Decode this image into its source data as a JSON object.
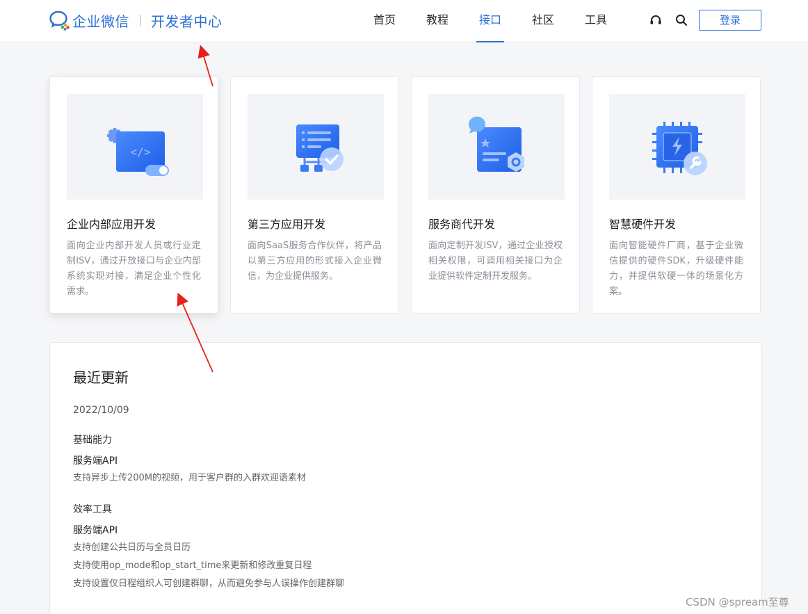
{
  "header": {
    "logo_text": "企业微信",
    "logo_sub": "开发者中心",
    "nav": [
      {
        "label": "首页",
        "active": false
      },
      {
        "label": "教程",
        "active": false
      },
      {
        "label": "接口",
        "active": true
      },
      {
        "label": "社区",
        "active": false
      },
      {
        "label": "工具",
        "active": false
      }
    ],
    "login_label": "登录",
    "brand_color": "#2a6fd6"
  },
  "cards": [
    {
      "title": "企业内部应用开发",
      "desc": "面向企业内部开发人员或行业定制ISV，通过开放接口与企业内部系统实现对接，满足企业个性化需求。",
      "icon": "code-window-icon"
    },
    {
      "title": "第三方应用开发",
      "desc": "面向SaaS服务合作伙伴，将产品以第三方应用的形式接入企业微信，为企业提供服务。",
      "icon": "third-party-app-icon"
    },
    {
      "title": "服务商代开发",
      "desc": "面向定制开发ISV，通过企业授权相关权限，可调用相关接口为企业提供软件定制开发服务。",
      "icon": "service-provider-icon"
    },
    {
      "title": "智慧硬件开发",
      "desc": "面向智能硬件厂商，基于企业微信提供的硬件SDK，升级硬件能力，并提供软硬一体的场景化方案。",
      "icon": "hardware-chip-icon"
    }
  ],
  "updates": {
    "title": "最近更新",
    "date": "2022/10/09",
    "categories": [
      {
        "name": "基础能力",
        "api": "服务端API",
        "items": [
          "支持异步上传200M的视频，用于客户群的入群欢迎语素材"
        ]
      },
      {
        "name": "效率工具",
        "api": "服务端API",
        "items": [
          "支持创建公共日历与全员日历",
          "支持使用op_mode和op_start_time来更新和修改重复日程",
          "支持设置仅日程组织人可创建群聊，从而避免参与人误操作创建群聊"
        ]
      }
    ]
  },
  "watermark": "CSDN @spream至尊"
}
